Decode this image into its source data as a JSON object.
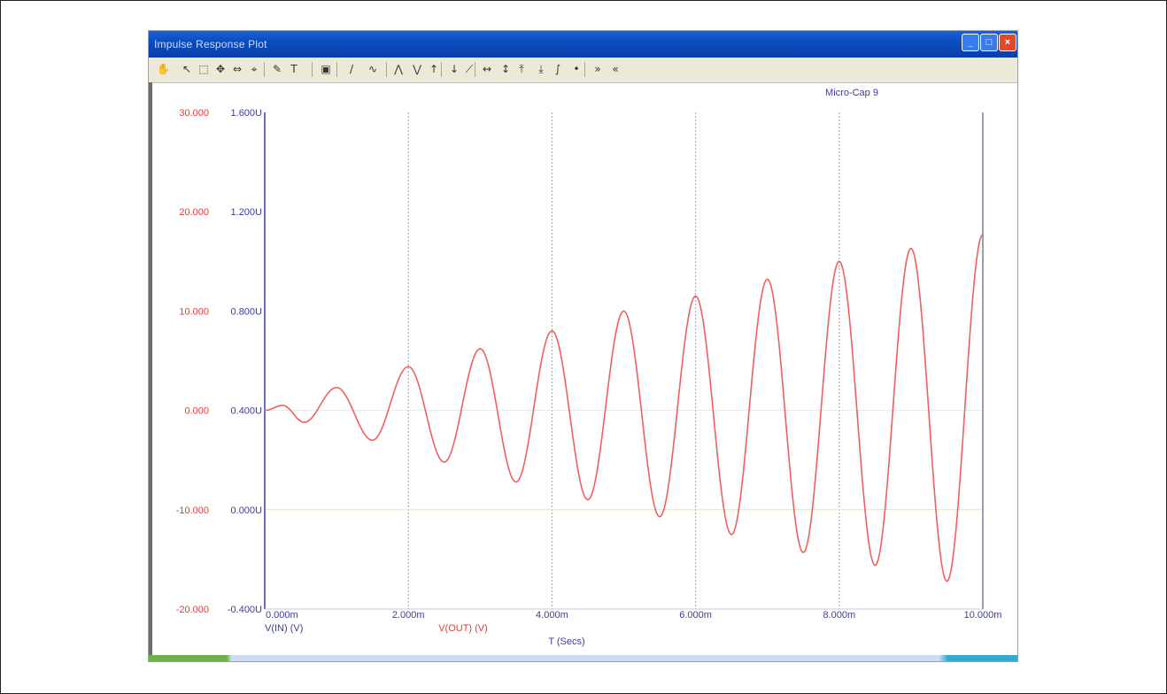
{
  "window": {
    "title": "Impulse Response Plot",
    "buttons": {
      "minimize": "_",
      "maximize": "□",
      "close": "×"
    }
  },
  "toolbar": {
    "icons": [
      "hand-icon",
      "pointer-icon",
      "zoom-box-icon",
      "pan-icon",
      "scale-icon",
      "cursor-mode-icon",
      "pen-icon",
      "text-icon",
      "properties-icon",
      "line-icon",
      "curve-icon",
      "peak-icon",
      "valley-icon",
      "high-icon",
      "bottom-icon",
      "slope-icon",
      "horizontal-icon",
      "vertical-icon",
      "global-high-icon",
      "global-low-icon",
      "inflection-icon",
      "point-icon",
      "next-icon",
      "prev-icon"
    ]
  },
  "plot": {
    "watermark": "Micro-Cap 9",
    "x_tick_labels": [
      "0.000m",
      "2.000m",
      "4.000m",
      "6.000m",
      "8.000m",
      "10.000m"
    ],
    "left_red_ticks": [
      "30.000",
      "20.000",
      "10.000",
      "0.000",
      "-10.000",
      "-20.000"
    ],
    "left_blue_ticks": [
      "1.600U",
      "1.200U",
      "0.800U",
      "0.400U",
      "0.000U",
      "-0.400U"
    ],
    "trace_label_in": "V(IN) (V)",
    "trace_label_out": "V(OUT) (V)",
    "xlabel": "T (Secs)",
    "colors": {
      "red_axis": "#e23b3b",
      "blue_axis": "#3a3e9a",
      "trace": "#f06060",
      "grid": "#9aa0b4",
      "zero_line": "#c7d8e8",
      "input_line": "#e6ea9a"
    }
  },
  "chart_data": {
    "type": "line",
    "xlabel": "T (Secs)",
    "x_unit": "ms",
    "xlim": [
      0,
      10
    ],
    "ylim_left": [
      -20,
      30
    ],
    "series": [
      {
        "name": "V(OUT) (V)",
        "x": [
          0.0,
          0.25,
          0.55,
          1.0,
          1.5,
          2.0,
          2.5,
          3.0,
          3.5,
          4.0,
          4.5,
          5.0,
          5.5,
          6.0,
          6.5,
          7.0,
          7.5,
          8.0,
          8.5,
          9.0,
          9.5,
          10.0
        ],
        "y": [
          0.0,
          0.5,
          -1.2,
          2.3,
          -3.0,
          4.4,
          -5.2,
          6.2,
          -7.2,
          8.0,
          -9.0,
          10.0,
          -10.7,
          11.5,
          -12.5,
          13.2,
          -14.3,
          15.0,
          -15.6,
          16.3,
          -17.2,
          17.7
        ]
      }
    ]
  }
}
